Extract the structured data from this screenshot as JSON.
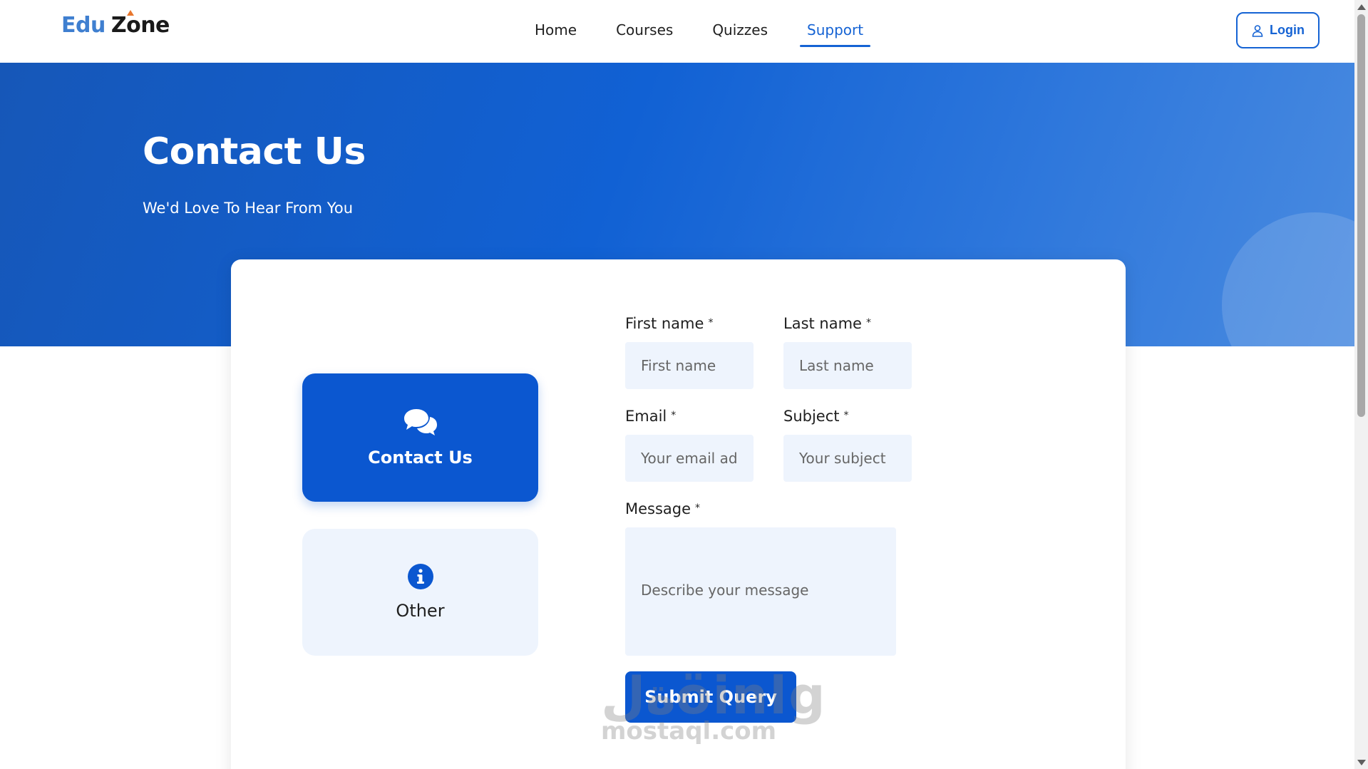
{
  "brand": {
    "part1": "Edu",
    "part2": "Zone"
  },
  "nav": {
    "items": [
      {
        "label": "Home"
      },
      {
        "label": "Courses"
      },
      {
        "label": "Quizzes"
      },
      {
        "label": "Support",
        "active": true
      }
    ],
    "login_label": "Login"
  },
  "hero": {
    "title": "Contact Us",
    "subtitle": "We'd Love To Hear From You"
  },
  "options": {
    "contact": {
      "label": "Contact Us",
      "icon": "chat-bubbles-icon"
    },
    "other": {
      "label": "Other",
      "icon": "info-icon"
    }
  },
  "form": {
    "first_name": {
      "label": "First name",
      "placeholder": "First name",
      "value": ""
    },
    "last_name": {
      "label": "Last name",
      "placeholder": "Last name",
      "value": ""
    },
    "email": {
      "label": "Email",
      "placeholder": "Your email address",
      "value": ""
    },
    "subject": {
      "label": "Subject",
      "placeholder": "Your subject",
      "value": ""
    },
    "message": {
      "label": "Message",
      "placeholder": "Describe your message",
      "value": ""
    },
    "required_mark": "*",
    "submit_label": "Submit Query"
  },
  "watermark": {
    "big": "ةلöinlg",
    "small": "mostaql.com"
  },
  "colors": {
    "primary": "#0b57d0",
    "accent_blue": "#1563d4",
    "logo_blue": "#3f7fd0",
    "logo_orange": "#e8772e",
    "input_bg": "#eef4fd"
  }
}
